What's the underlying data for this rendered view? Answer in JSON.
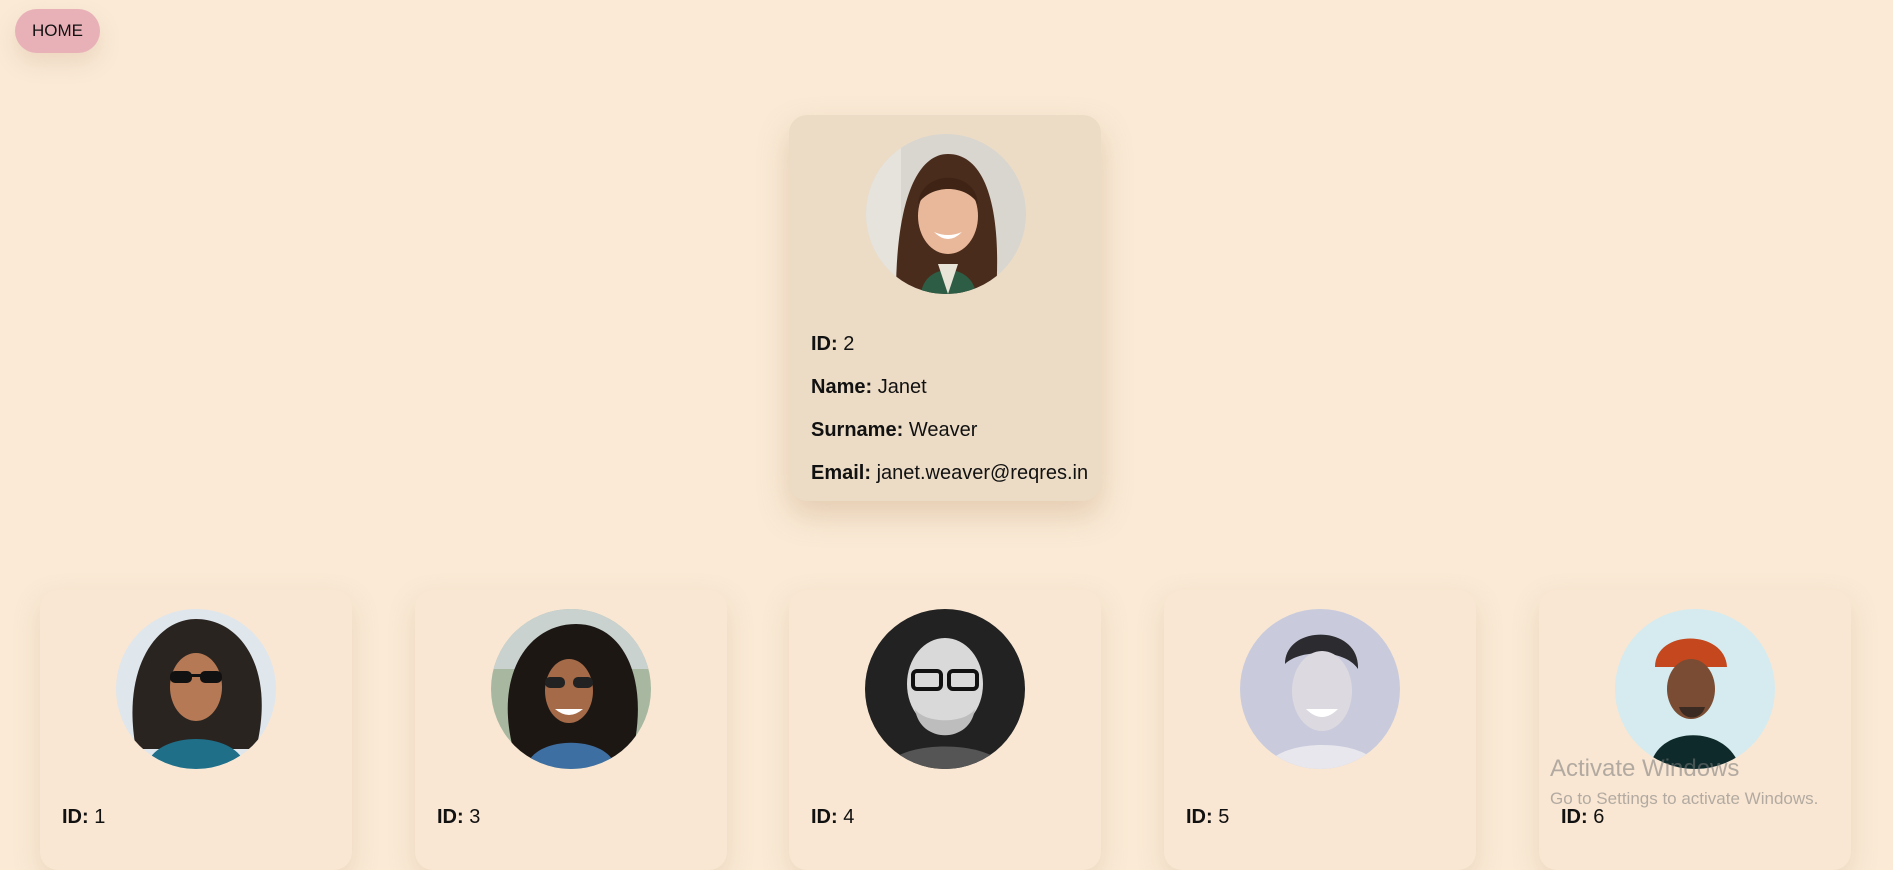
{
  "nav": {
    "home_label": "HOME"
  },
  "featured_user": {
    "id_label": "ID:",
    "id": "2",
    "name_label": "Name:",
    "name": "Janet",
    "surname_label": "Surname:",
    "surname": "Weaver",
    "email_label": "Email:",
    "email": "janet.weaver@reqres.in"
  },
  "users": [
    {
      "id_label": "ID:",
      "id": "1"
    },
    {
      "id_label": "ID:",
      "id": "3"
    },
    {
      "id_label": "ID:",
      "id": "4"
    },
    {
      "id_label": "ID:",
      "id": "5"
    },
    {
      "id_label": "ID:",
      "id": "6"
    }
  ],
  "watermark": {
    "title": "Activate Windows",
    "subtitle": "Go to Settings to activate Windows."
  }
}
